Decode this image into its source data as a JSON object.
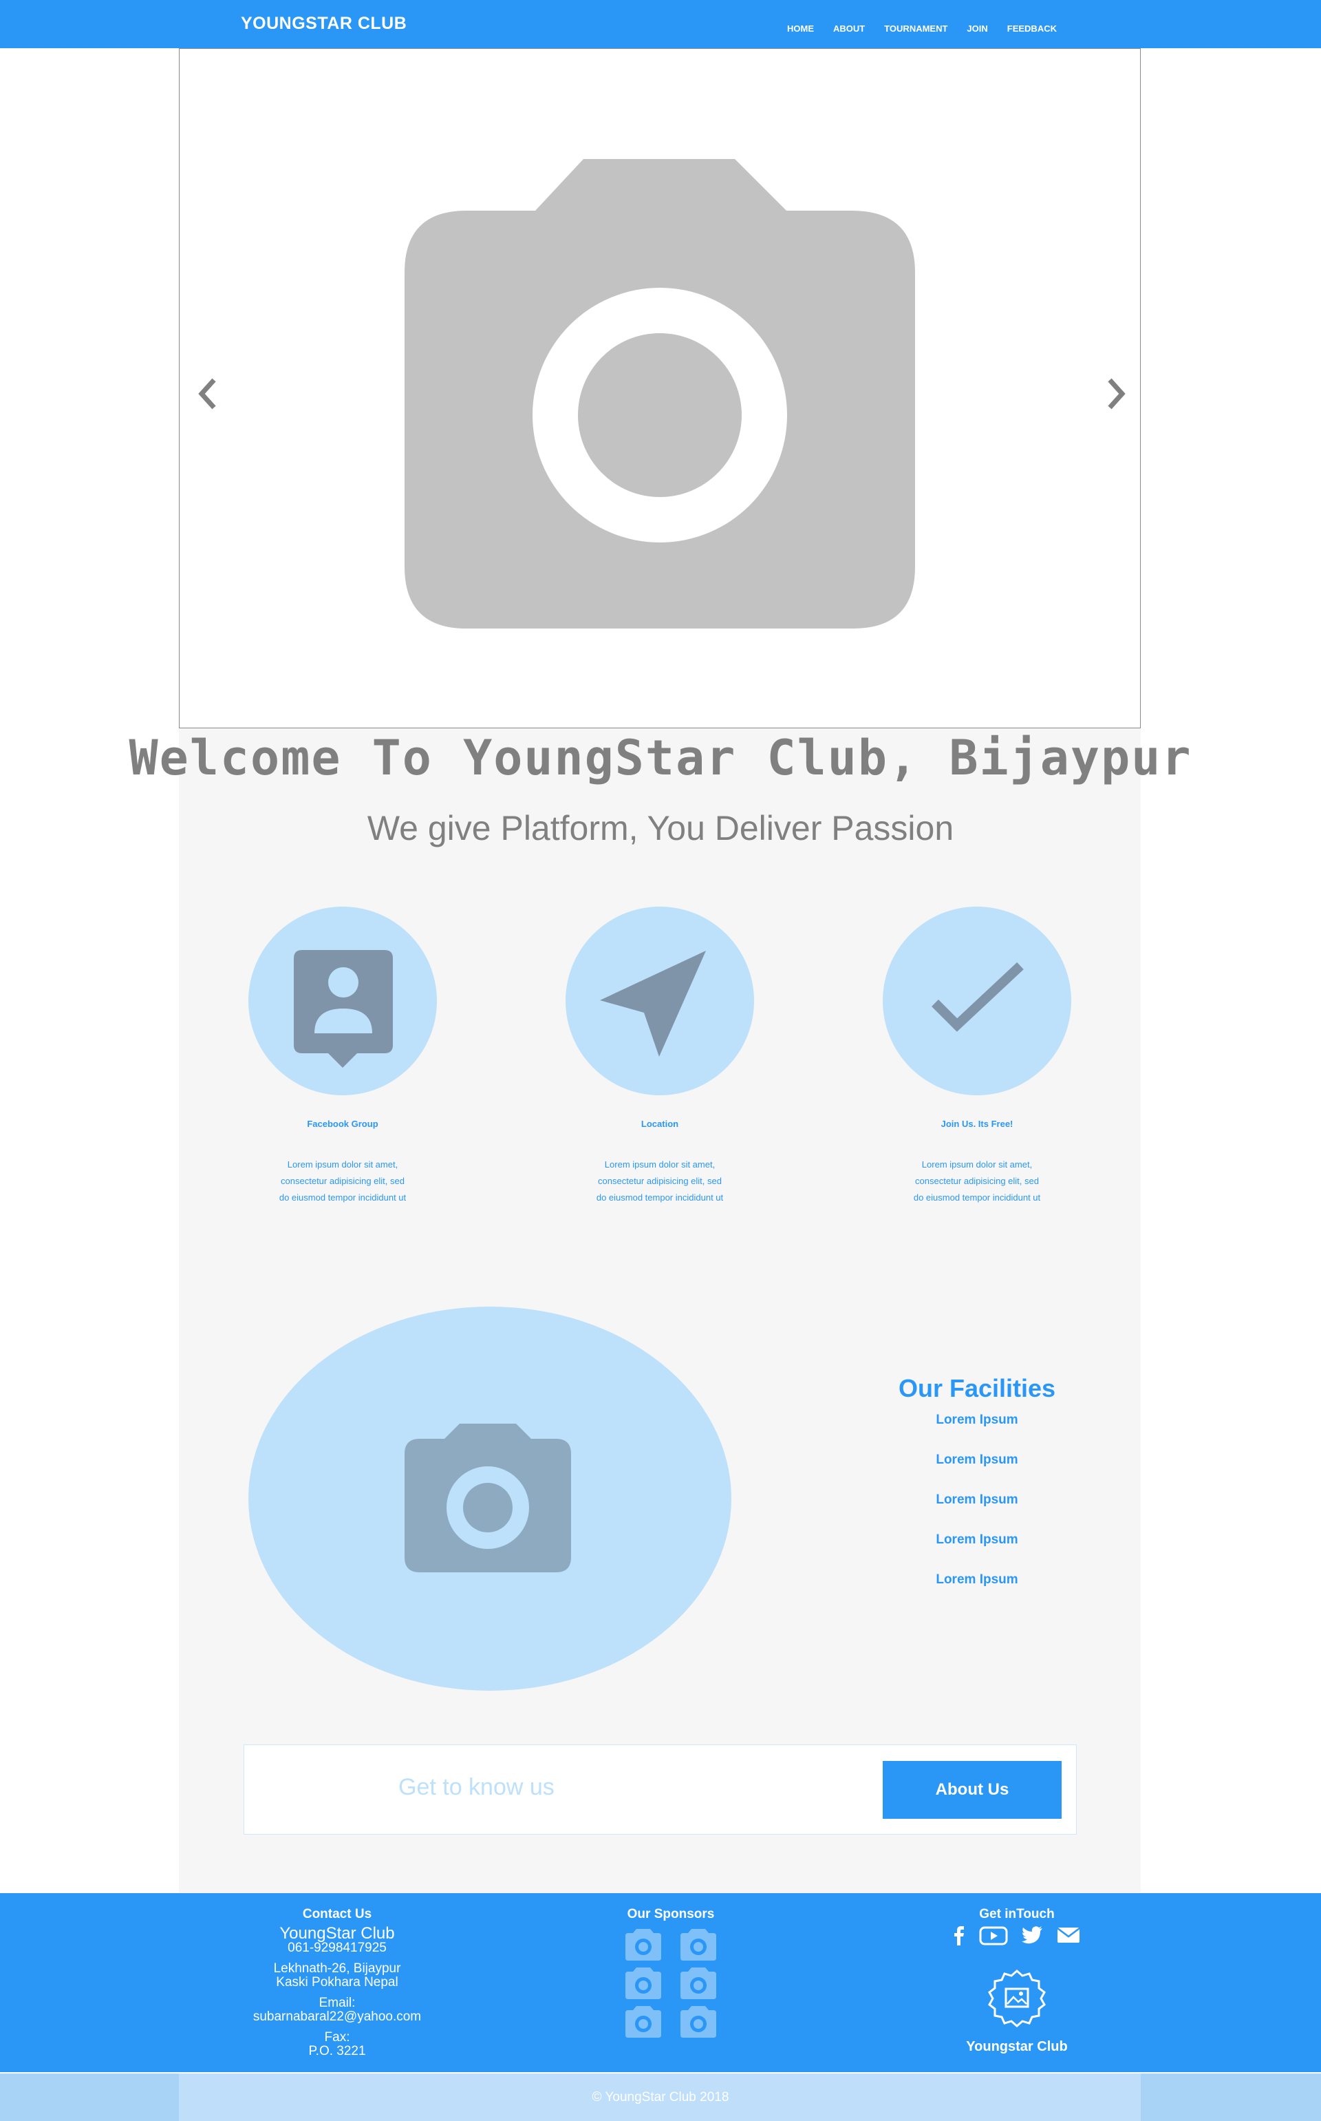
{
  "header": {
    "brand": "YOUNGSTAR CLUB",
    "nav": [
      "HOME",
      "ABOUT",
      "TOURNAMENT",
      "JOIN",
      "FEEDBACK"
    ]
  },
  "hero": {
    "title": "Welcome To YoungStar Club, Bijaypur",
    "tagline": "We give Platform, You Deliver Passion"
  },
  "features": [
    {
      "icon": "contact-icon",
      "title": "Facebook Group",
      "lines": [
        "Lorem ipsum dolor sit amet,",
        "consectetur adipisicing elit, sed",
        "do eiusmod tempor incididunt ut"
      ]
    },
    {
      "icon": "navigation-icon",
      "title": "Location",
      "lines": [
        "Lorem ipsum dolor sit amet,",
        "consectetur adipisicing elit, sed",
        "do eiusmod tempor incididunt ut"
      ]
    },
    {
      "icon": "check-icon",
      "title": "Join Us. Its Free!",
      "lines": [
        "Lorem ipsum dolor sit amet,",
        "consectetur adipisicing elit, sed",
        "do eiusmod tempor incididunt ut"
      ]
    }
  ],
  "facilities": {
    "title": "Our Facilities",
    "items": [
      "Lorem Ipsum",
      "Lorem Ipsum",
      "Lorem Ipsum",
      "Lorem Ipsum",
      "Lorem Ipsum"
    ]
  },
  "cta": {
    "text": "Get to know us",
    "button": "About Us"
  },
  "footer": {
    "contact": {
      "heading": "Contact Us",
      "name": "YoungStar Club",
      "phone": "061-9298417925",
      "address1": "Lekhnath-26, Bijaypur",
      "address2": "Kaski Pokhara Nepal",
      "email_label": "Email:",
      "email": "subarnabaral22@yahoo.com",
      "fax_label": "Fax:",
      "fax": "P.O. 3221"
    },
    "sponsors_heading": "Our Sponsors",
    "touch_heading": "Get inTouch",
    "badge_name": "Youngstar Club"
  },
  "copyright": "© YoungStar Club 2018",
  "colors": {
    "primary": "#2a97f7",
    "light_blue": "#bde0fb",
    "icon_grey": "#7f94a8",
    "text_grey": "#808080"
  }
}
